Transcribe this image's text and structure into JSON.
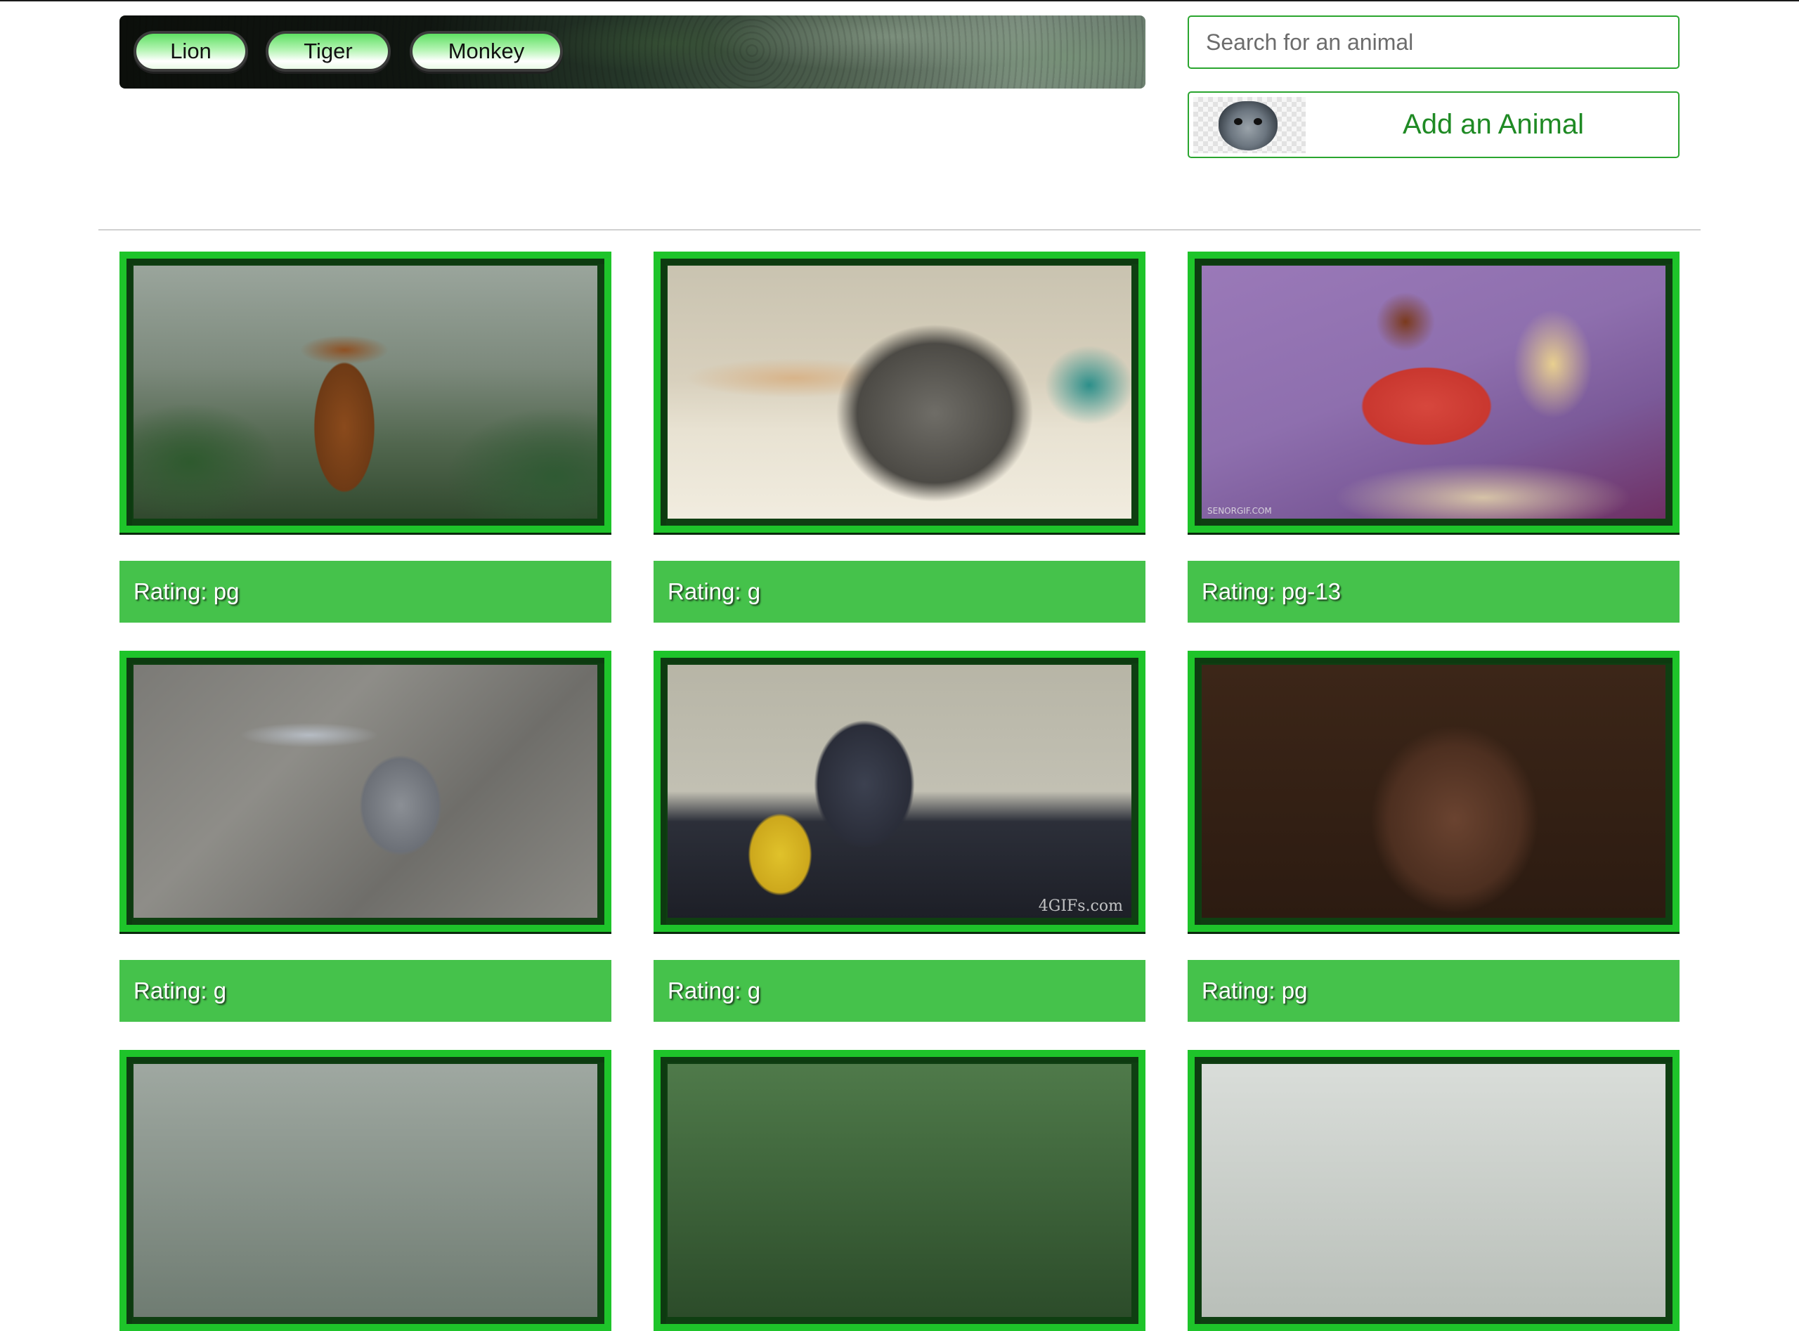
{
  "nav": {
    "animal_buttons": [
      "Lion",
      "Tiger",
      "Monkey"
    ]
  },
  "search": {
    "placeholder": "Search for an animal",
    "value": ""
  },
  "add_animal": {
    "label": "Add an Animal",
    "icon": "wolf-thumbnail-icon"
  },
  "colors": {
    "accent_green": "#45c24b",
    "frame_green": "#1ec42a",
    "button_text_green": "#1f8a24"
  },
  "gifs": [
    {
      "rating": "Rating: pg",
      "watermark": ""
    },
    {
      "rating": "Rating: g",
      "watermark": ""
    },
    {
      "rating": "Rating: pg-13",
      "watermark": "SENORGIF.COM"
    },
    {
      "rating": "Rating: g",
      "watermark": ""
    },
    {
      "rating": "Rating: g",
      "watermark": "4GIFs.com"
    },
    {
      "rating": "Rating: pg",
      "watermark": ""
    },
    {
      "rating": "",
      "watermark": ""
    },
    {
      "rating": "",
      "watermark": ""
    },
    {
      "rating": "",
      "watermark": ""
    }
  ]
}
